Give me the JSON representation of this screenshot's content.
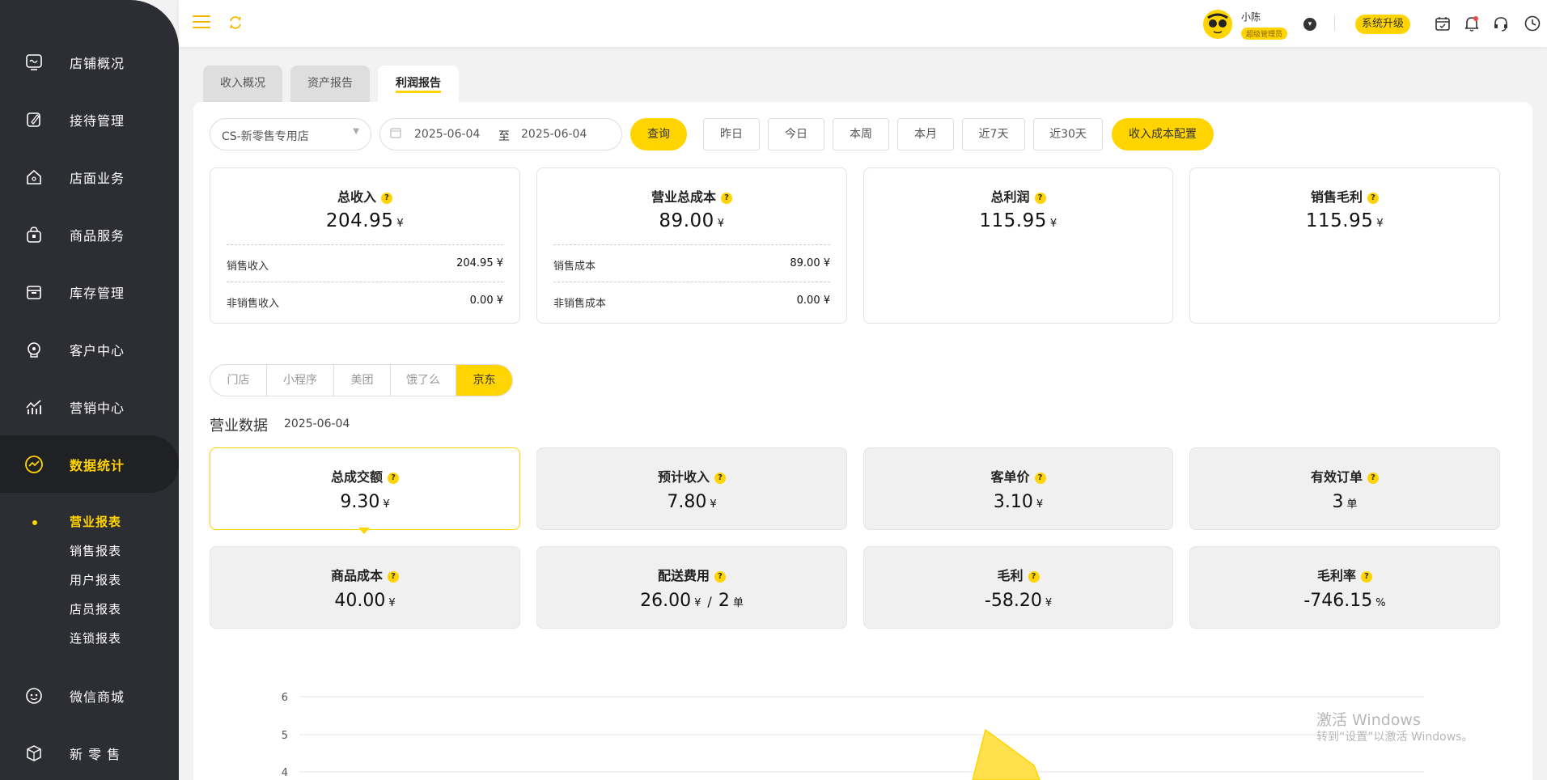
{
  "sidebar": {
    "items": [
      {
        "label": "店铺概况",
        "icon": "monitor-icon"
      },
      {
        "label": "接待管理",
        "icon": "edit-icon"
      },
      {
        "label": "店面业务",
        "icon": "house-icon"
      },
      {
        "label": "商品服务",
        "icon": "bag-icon"
      },
      {
        "label": "库存管理",
        "icon": "box-icon"
      },
      {
        "label": "客户中心",
        "icon": "headset-icon"
      },
      {
        "label": "营销中心",
        "icon": "chart-up-icon"
      },
      {
        "label": "数据统计",
        "icon": "trend-icon"
      },
      {
        "label": "微信商城",
        "icon": "wechat-icon"
      },
      {
        "label": "新 零 售",
        "icon": "cube-icon"
      }
    ],
    "sub_items": [
      "营业报表",
      "销售报表",
      "用户报表",
      "店员报表",
      "连锁报表"
    ]
  },
  "header": {
    "user_name": "小陈",
    "user_role": "超级管理员",
    "upgrade_label": "系统升级"
  },
  "tabs": [
    "收入概况",
    "资产报告",
    "利润报告"
  ],
  "filters": {
    "store": "CS-新零售专用店",
    "date_start": "2025-06-04",
    "date_sep": "至",
    "date_end": "2025-06-04",
    "query_label": "查询",
    "quick": [
      "昨日",
      "今日",
      "本周",
      "本月",
      "近7天",
      "近30天"
    ],
    "config_label": "收入成本配置"
  },
  "summary": {
    "income": {
      "title": "总收入",
      "value": "204.95",
      "unit": "¥",
      "rows": [
        {
          "label": "销售收入",
          "value": "204.95 ¥"
        },
        {
          "label": "非销售收入",
          "value": "0.00 ¥"
        }
      ]
    },
    "cost": {
      "title": "营业总成本",
      "value": "89.00",
      "unit": "¥",
      "rows": [
        {
          "label": "销售成本",
          "value": "89.00 ¥"
        },
        {
          "label": "非销售成本",
          "value": "0.00 ¥"
        }
      ]
    },
    "profit": {
      "title": "总利润",
      "value": "115.95",
      "unit": "¥"
    },
    "gross": {
      "title": "销售毛利",
      "value": "115.95",
      "unit": "¥"
    }
  },
  "channels": [
    "门店",
    "小程序",
    "美团",
    "饿了么",
    "京东"
  ],
  "business": {
    "title": "营业数据",
    "date": "2025-06-04",
    "metrics": [
      {
        "title": "总成交额",
        "value": "9.30",
        "unit": "¥"
      },
      {
        "title": "预计收入",
        "value": "7.80",
        "unit": "¥"
      },
      {
        "title": "客单价",
        "value": "3.10",
        "unit": "¥"
      },
      {
        "title": "有效订单",
        "value": "3",
        "unit": "单"
      },
      {
        "title": "商品成本",
        "value": "40.00",
        "unit": "¥"
      },
      {
        "title": "配送费用",
        "value": "26.00",
        "unit": "¥",
        "extra_sep": "/",
        "extra_value": "2",
        "extra_unit": "单"
      },
      {
        "title": "毛利",
        "value": "-58.20",
        "unit": "¥"
      },
      {
        "title": "毛利率",
        "value": "-746.15",
        "unit": "%"
      }
    ]
  },
  "chart": {
    "y_ticks": [
      "6",
      "5",
      "4"
    ]
  },
  "watermark": {
    "line1": "激活 Windows",
    "line2": "转到“设置”以激活 Windows。"
  }
}
